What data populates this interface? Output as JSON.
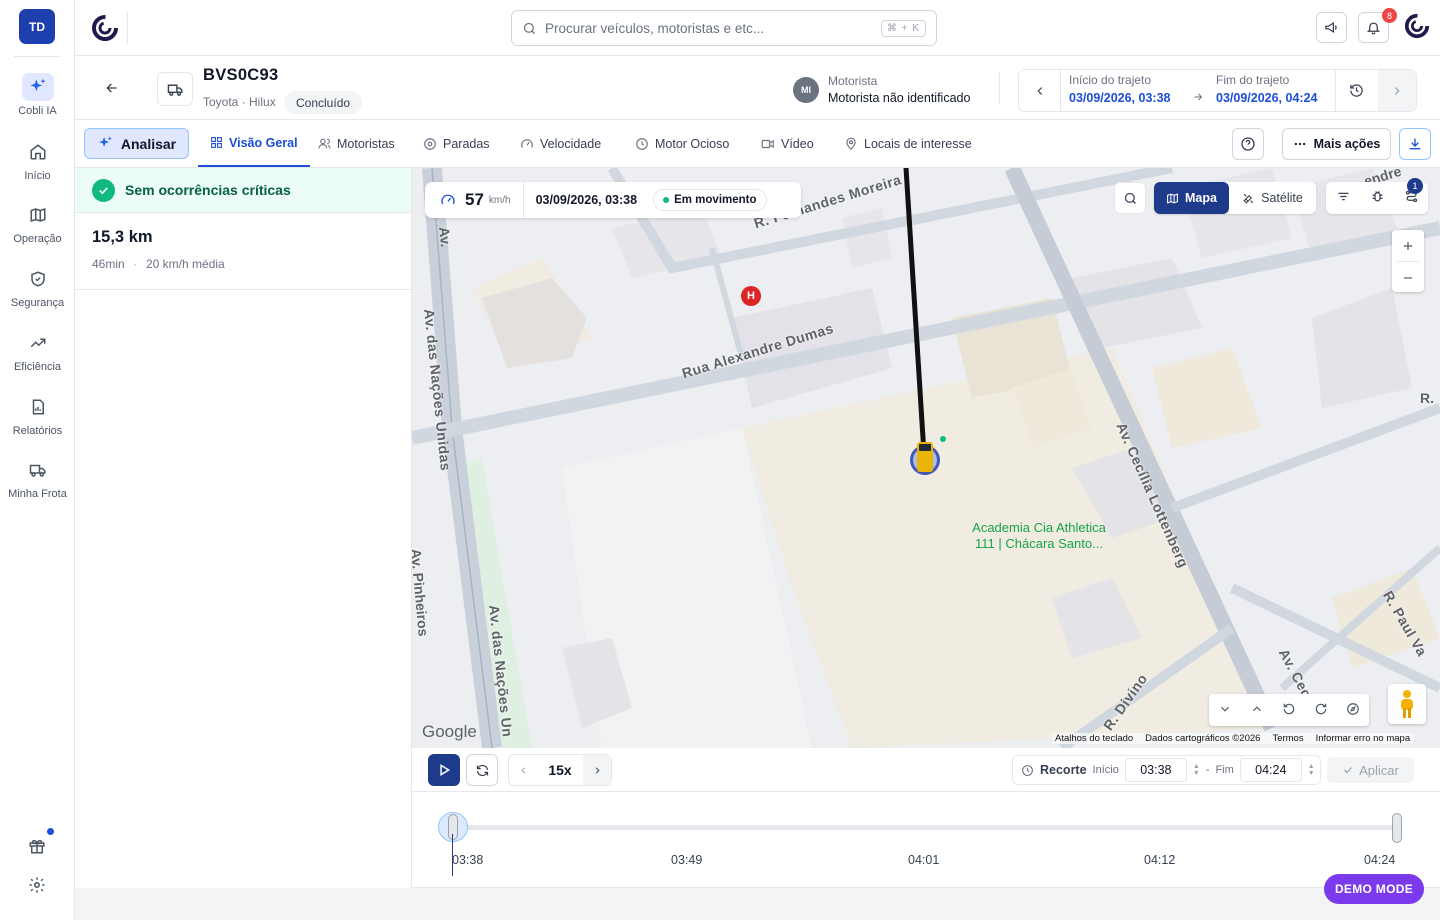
{
  "sidebar": {
    "avatar_initials": "TD",
    "items": [
      {
        "label": "Cobli IA",
        "icon": "sparkles-icon"
      },
      {
        "label": "Início",
        "icon": "home-icon"
      },
      {
        "label": "Operação",
        "icon": "map-icon"
      },
      {
        "label": "Segurança",
        "icon": "shield-icon"
      },
      {
        "label": "Eficiência",
        "icon": "trending-up-icon"
      },
      {
        "label": "Relatórios",
        "icon": "report-icon"
      },
      {
        "label": "Minha Frota",
        "icon": "truck-icon"
      }
    ],
    "bottom_icons": [
      "gift-icon",
      "settings-icon"
    ]
  },
  "topbar": {
    "search_placeholder": "Procurar veículos, motoristas e etc...",
    "search_shortcut": "⌘ + K",
    "notification_count": "8"
  },
  "vehicle": {
    "plate": "BVS0C93",
    "model": "Toyota · Hilux",
    "status": "Concluído",
    "driver_initials": "MI",
    "driver_label": "Motorista",
    "driver_name": "Motorista não identificado",
    "trip_start_label": "Início do trajeto",
    "trip_start": "03/09/2026, 03:38",
    "trip_end_label": "Fim do trajeto",
    "trip_end": "03/09/2026, 04:24"
  },
  "tabs": {
    "analyze_label": "Analisar",
    "items": [
      {
        "label": "Visão Geral",
        "active": true
      },
      {
        "label": "Motoristas"
      },
      {
        "label": "Paradas"
      },
      {
        "label": "Velocidade"
      },
      {
        "label": "Motor Ocioso"
      },
      {
        "label": "Vídeo"
      },
      {
        "label": "Locais de interesse"
      }
    ],
    "more_actions": "Mais ações"
  },
  "summary": {
    "alert_text": "Sem ocorrências críticas",
    "distance": "15,3 km",
    "duration": "46min",
    "separator": "·",
    "avg_speed": "20 km/h média"
  },
  "map": {
    "speed_value": "57",
    "speed_unit": "km/h",
    "timestamp": "03/09/2026, 03:38",
    "moving_status": "Em movimento",
    "mode_map": "Mapa",
    "mode_satellite": "Satélite",
    "filter_badge": "1",
    "streets": [
      "R. Fernandes Moreira",
      "Rua Alexandre Dumas",
      "Av. das Nações Unidas",
      "Av. das Nações Un",
      "Av. Cecília Lottenberg",
      "R. Paul Va",
      "Av. Ceci",
      "R. Divino",
      "Av.",
      "R.",
      "Av. Pinheiros",
      "endre"
    ],
    "poi_line1": "Academia Cia Athletica",
    "poi_line2": "111 | Chácara Santo...",
    "hospital_marker": "H",
    "google_logo": "Google",
    "attribution": [
      "Atalhos do teclado",
      "Dados cartográficos ©2026",
      "Termos",
      "Informar erro no mapa"
    ]
  },
  "playback": {
    "speed": "15x",
    "recorte_label": "Recorte",
    "start_label": "Início",
    "start_value": "03:38",
    "dash": "-",
    "end_label": "Fim",
    "end_value": "04:24",
    "apply_label": "Aplicar",
    "ticks": [
      "03:38",
      "03:49",
      "04:01",
      "04:12",
      "04:24"
    ],
    "progress": 0
  },
  "demo_mode": "DEMO MODE"
}
